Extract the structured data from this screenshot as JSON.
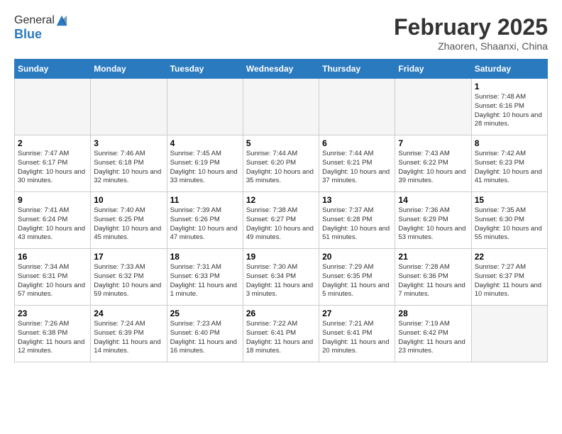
{
  "header": {
    "logo_line1": "General",
    "logo_line2": "Blue",
    "month": "February 2025",
    "location": "Zhaoren, Shaanxi, China"
  },
  "weekdays": [
    "Sunday",
    "Monday",
    "Tuesday",
    "Wednesday",
    "Thursday",
    "Friday",
    "Saturday"
  ],
  "weeks": [
    [
      {
        "day": "",
        "info": ""
      },
      {
        "day": "",
        "info": ""
      },
      {
        "day": "",
        "info": ""
      },
      {
        "day": "",
        "info": ""
      },
      {
        "day": "",
        "info": ""
      },
      {
        "day": "",
        "info": ""
      },
      {
        "day": "1",
        "info": "Sunrise: 7:48 AM\nSunset: 6:16 PM\nDaylight: 10 hours and 28 minutes."
      }
    ],
    [
      {
        "day": "2",
        "info": "Sunrise: 7:47 AM\nSunset: 6:17 PM\nDaylight: 10 hours and 30 minutes."
      },
      {
        "day": "3",
        "info": "Sunrise: 7:46 AM\nSunset: 6:18 PM\nDaylight: 10 hours and 32 minutes."
      },
      {
        "day": "4",
        "info": "Sunrise: 7:45 AM\nSunset: 6:19 PM\nDaylight: 10 hours and 33 minutes."
      },
      {
        "day": "5",
        "info": "Sunrise: 7:44 AM\nSunset: 6:20 PM\nDaylight: 10 hours and 35 minutes."
      },
      {
        "day": "6",
        "info": "Sunrise: 7:44 AM\nSunset: 6:21 PM\nDaylight: 10 hours and 37 minutes."
      },
      {
        "day": "7",
        "info": "Sunrise: 7:43 AM\nSunset: 6:22 PM\nDaylight: 10 hours and 39 minutes."
      },
      {
        "day": "8",
        "info": "Sunrise: 7:42 AM\nSunset: 6:23 PM\nDaylight: 10 hours and 41 minutes."
      }
    ],
    [
      {
        "day": "9",
        "info": "Sunrise: 7:41 AM\nSunset: 6:24 PM\nDaylight: 10 hours and 43 minutes."
      },
      {
        "day": "10",
        "info": "Sunrise: 7:40 AM\nSunset: 6:25 PM\nDaylight: 10 hours and 45 minutes."
      },
      {
        "day": "11",
        "info": "Sunrise: 7:39 AM\nSunset: 6:26 PM\nDaylight: 10 hours and 47 minutes."
      },
      {
        "day": "12",
        "info": "Sunrise: 7:38 AM\nSunset: 6:27 PM\nDaylight: 10 hours and 49 minutes."
      },
      {
        "day": "13",
        "info": "Sunrise: 7:37 AM\nSunset: 6:28 PM\nDaylight: 10 hours and 51 minutes."
      },
      {
        "day": "14",
        "info": "Sunrise: 7:36 AM\nSunset: 6:29 PM\nDaylight: 10 hours and 53 minutes."
      },
      {
        "day": "15",
        "info": "Sunrise: 7:35 AM\nSunset: 6:30 PM\nDaylight: 10 hours and 55 minutes."
      }
    ],
    [
      {
        "day": "16",
        "info": "Sunrise: 7:34 AM\nSunset: 6:31 PM\nDaylight: 10 hours and 57 minutes."
      },
      {
        "day": "17",
        "info": "Sunrise: 7:33 AM\nSunset: 6:32 PM\nDaylight: 10 hours and 59 minutes."
      },
      {
        "day": "18",
        "info": "Sunrise: 7:31 AM\nSunset: 6:33 PM\nDaylight: 11 hours and 1 minute."
      },
      {
        "day": "19",
        "info": "Sunrise: 7:30 AM\nSunset: 6:34 PM\nDaylight: 11 hours and 3 minutes."
      },
      {
        "day": "20",
        "info": "Sunrise: 7:29 AM\nSunset: 6:35 PM\nDaylight: 11 hours and 5 minutes."
      },
      {
        "day": "21",
        "info": "Sunrise: 7:28 AM\nSunset: 6:36 PM\nDaylight: 11 hours and 7 minutes."
      },
      {
        "day": "22",
        "info": "Sunrise: 7:27 AM\nSunset: 6:37 PM\nDaylight: 11 hours and 10 minutes."
      }
    ],
    [
      {
        "day": "23",
        "info": "Sunrise: 7:26 AM\nSunset: 6:38 PM\nDaylight: 11 hours and 12 minutes."
      },
      {
        "day": "24",
        "info": "Sunrise: 7:24 AM\nSunset: 6:39 PM\nDaylight: 11 hours and 14 minutes."
      },
      {
        "day": "25",
        "info": "Sunrise: 7:23 AM\nSunset: 6:40 PM\nDaylight: 11 hours and 16 minutes."
      },
      {
        "day": "26",
        "info": "Sunrise: 7:22 AM\nSunset: 6:41 PM\nDaylight: 11 hours and 18 minutes."
      },
      {
        "day": "27",
        "info": "Sunrise: 7:21 AM\nSunset: 6:41 PM\nDaylight: 11 hours and 20 minutes."
      },
      {
        "day": "28",
        "info": "Sunrise: 7:19 AM\nSunset: 6:42 PM\nDaylight: 11 hours and 23 minutes."
      },
      {
        "day": "",
        "info": ""
      }
    ]
  ]
}
